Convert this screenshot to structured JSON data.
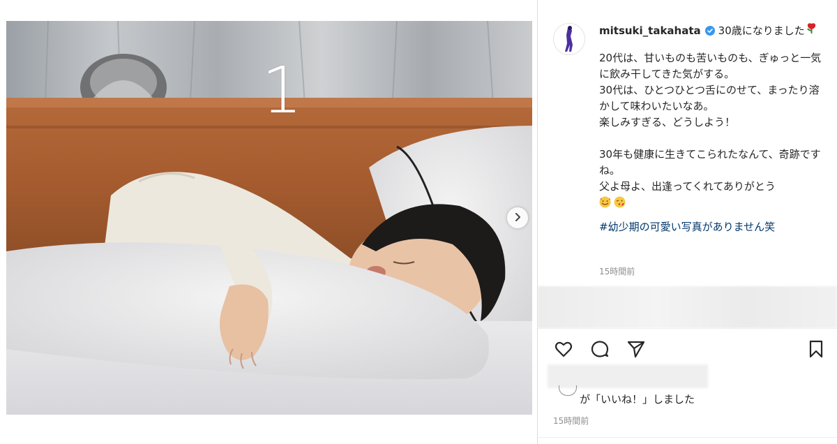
{
  "photo": {
    "slide_number": "1"
  },
  "post": {
    "username": "mitsuki_takahata",
    "title": "30歳になりました",
    "body": "20代は、甘いものも苦いものも、ぎゅっと一気に飲み干してきた気がする。\n30代は、ひとつひとつ舌にのせて、まったり溶かして味わいたいなあ。\n楽しみすぎる、どうしよう！\n\n30年も健康に生きてこられたなんて、奇跡ですね。\n父よ母よ、出逢ってくれてありがとう",
    "hashtag": "#幼少期の可愛い写真がありません笑",
    "caption_time": "15時間前",
    "likes_text": "が「いいね！」しました",
    "post_time": "15時間前"
  },
  "icons": {
    "verified": "verified-badge-icon",
    "rose": "rose-emoji",
    "emoji_1": "smiling-face-with-hearts-emoji",
    "emoji_2": "face-blowing-kiss-emoji",
    "like": "heart-icon",
    "comment": "comment-icon",
    "share": "paper-plane-icon",
    "save": "bookmark-icon",
    "next": "chevron-right-icon"
  },
  "colors": {
    "verified_blue": "#3897f0",
    "hashtag": "#00376b",
    "muted": "#8e8e8e",
    "text": "#262626"
  }
}
